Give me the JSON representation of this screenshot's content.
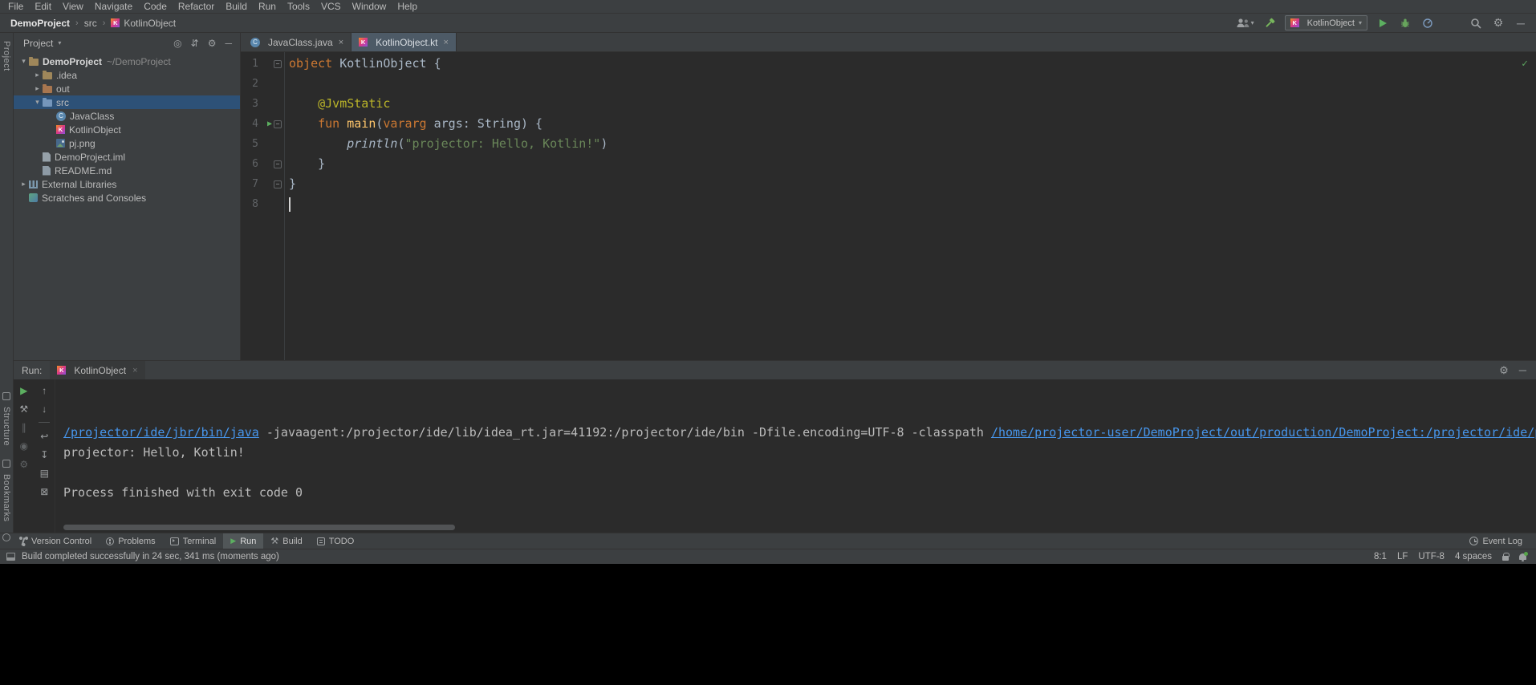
{
  "menubar": {
    "items": [
      "File",
      "Edit",
      "View",
      "Navigate",
      "Code",
      "Refactor",
      "Build",
      "Run",
      "Tools",
      "VCS",
      "Window",
      "Help"
    ]
  },
  "navbar": {
    "separator": "›",
    "crumbs": [
      {
        "label": "DemoProject",
        "bold": true
      },
      {
        "label": "src"
      },
      {
        "label": "KotlinObject",
        "icon": "kotlin"
      }
    ],
    "run_config": {
      "label": "KotlinObject"
    }
  },
  "stripe": {
    "project_label": "Project",
    "structure_label": "Structure",
    "bookmarks_label": "Bookmarks"
  },
  "project": {
    "title": "Project",
    "header_icons": [
      {
        "name": "locate-file",
        "glyph": "◎"
      },
      {
        "name": "collapse-all",
        "glyph": "⇵"
      },
      {
        "name": "panel-settings",
        "glyph": "⚙"
      },
      {
        "name": "hide-panel",
        "glyph": "─"
      }
    ],
    "tree": [
      {
        "indent": 0,
        "arrow": "open",
        "icon": "folder",
        "label": "DemoProject",
        "suffix": "~/DemoProject",
        "bold": true
      },
      {
        "indent": 1,
        "arrow": "closed",
        "icon": "folder",
        "label": ".idea"
      },
      {
        "indent": 1,
        "arrow": "closed",
        "icon": "folder-excluded",
        "label": "out"
      },
      {
        "indent": 1,
        "arrow": "open",
        "icon": "folder-src",
        "label": "src",
        "state": "selected"
      },
      {
        "indent": 2,
        "icon": "class",
        "label": "JavaClass"
      },
      {
        "indent": 2,
        "icon": "kotlin",
        "label": "KotlinObject"
      },
      {
        "indent": 2,
        "icon": "image",
        "label": "pj.png"
      },
      {
        "indent": 1,
        "icon": "iml",
        "label": "DemoProject.iml"
      },
      {
        "indent": 1,
        "icon": "md",
        "label": "README.md"
      },
      {
        "indent": 0,
        "arrow": "closed",
        "icon": "library",
        "label": "External Libraries"
      },
      {
        "indent": 0,
        "icon": "scratch",
        "label": "Scratches and Consoles"
      }
    ]
  },
  "editor": {
    "tabs": [
      {
        "label": "JavaClass.java",
        "icon": "class",
        "active": false
      },
      {
        "label": "KotlinObject.kt",
        "icon": "kotlin",
        "active": true
      }
    ],
    "lines": [
      {
        "n": "1",
        "fold": true,
        "parts": [
          [
            "object",
            "kw"
          ],
          [
            " KotlinObject {",
            ""
          ]
        ]
      },
      {
        "n": "2",
        "parts": []
      },
      {
        "n": "3",
        "parts": [
          [
            "    ",
            ""
          ],
          [
            "@JvmStatic",
            "ann"
          ]
        ]
      },
      {
        "n": "4",
        "run": true,
        "fold": true,
        "parts": [
          [
            "    ",
            ""
          ],
          [
            "fun",
            "kw"
          ],
          [
            " ",
            ""
          ],
          [
            "main",
            "fn"
          ],
          [
            "(",
            ""
          ],
          [
            "vararg",
            "kw"
          ],
          [
            " args: String) {",
            ""
          ]
        ]
      },
      {
        "n": "5",
        "parts": [
          [
            "        ",
            ""
          ],
          [
            "println",
            "call"
          ],
          [
            "(",
            ""
          ],
          [
            "\"projector: Hello, Kotlin!\"",
            "str"
          ],
          [
            ")",
            ""
          ]
        ]
      },
      {
        "n": "6",
        "fold": true,
        "parts": [
          [
            "    }",
            ""
          ]
        ]
      },
      {
        "n": "7",
        "fold": true,
        "parts": [
          [
            "}",
            ""
          ]
        ]
      },
      {
        "n": "8",
        "caret": true,
        "parts": []
      }
    ]
  },
  "run": {
    "title": "Run:",
    "tab": {
      "label": "KotlinObject",
      "icon": "kotlin"
    },
    "header_icons": [
      {
        "name": "console-settings",
        "glyph": "⚙"
      },
      {
        "name": "hide-console",
        "glyph": "─"
      }
    ],
    "toolbar_col1": [
      {
        "name": "rerun",
        "glyph": "▶",
        "cls": "green"
      },
      {
        "name": "run-settings",
        "glyph": "⚒",
        "cls": ""
      },
      {
        "name": "pause-output",
        "glyph": "∥",
        "cls": "dim"
      },
      {
        "name": "screenshot",
        "glyph": "◉",
        "cls": "dim"
      },
      {
        "name": "console-gear",
        "glyph": "⚙",
        "cls": "dim"
      }
    ],
    "toolbar_col2": [
      {
        "name": "up-stack-trace",
        "glyph": "↑",
        "cls": ""
      },
      {
        "name": "down-stack-trace",
        "glyph": "↓",
        "cls": ""
      },
      {
        "name": "soft-wrap",
        "glyph": "↩",
        "cls": ""
      },
      {
        "name": "scroll-to-end",
        "glyph": "↧",
        "cls": ""
      },
      {
        "name": "print",
        "glyph": "▤",
        "cls": ""
      },
      {
        "name": "clear-all",
        "glyph": "⊠",
        "cls": ""
      }
    ],
    "console": [
      {
        "segs": [
          [
            "/projector/ide/jbr/bin/java",
            "link"
          ],
          [
            " -javaagent:/projector/ide/lib/idea_rt.jar=41192:/projector/ide/bin -Dfile.encoding=UTF-8 -classpath ",
            ""
          ],
          [
            "/home/projector-user/DemoProject/out/production/DemoProject:/projector/ide/plugins/Kotlin/kotlinc/lib/kotlin-stdlib.jar",
            "link"
          ]
        ]
      },
      {
        "segs": [
          [
            "projector: Hello, Kotlin!",
            ""
          ]
        ]
      },
      {
        "segs": []
      },
      {
        "segs": [
          [
            "Process finished with exit code 0",
            ""
          ]
        ]
      }
    ]
  },
  "bottombar": {
    "left": [
      {
        "label": "Version Control",
        "icon": "branch"
      },
      {
        "label": "Problems",
        "icon": "problems"
      },
      {
        "label": "Terminal",
        "icon": "terminal"
      },
      {
        "label": "Run",
        "icon": "run",
        "active": true
      },
      {
        "label": "Build",
        "icon": "build"
      },
      {
        "label": "TODO",
        "icon": "todo"
      }
    ],
    "right": [
      {
        "label": "Event Log",
        "icon": "clock"
      }
    ]
  },
  "statusbar": {
    "message": "Build completed successfully in 24 sec, 341 ms (moments ago)",
    "caret_position": "8:1",
    "line_ending": "LF",
    "encoding": "UTF-8",
    "indent_style": "4 spaces"
  },
  "icons": {
    "kotlin": "K",
    "class": "C",
    "run": "▶",
    "build": "⚒",
    "gear": "⚙",
    "caret_down": "▾",
    "minimize": "─",
    "close": "×",
    "fold": "−",
    "check": "✓",
    "arrow_open": "▾",
    "arrow_closed": "▸"
  },
  "colors": {
    "panel_bg": "#3c3f41",
    "editor_bg": "#2b2b2b",
    "selection": "#2d5177",
    "keyword": "#cc7832",
    "annotation": "#bbb529",
    "string": "#6a8759",
    "function_name": "#ffc66b",
    "link_blue": "#4796ec",
    "run_green": "#5caf60"
  }
}
